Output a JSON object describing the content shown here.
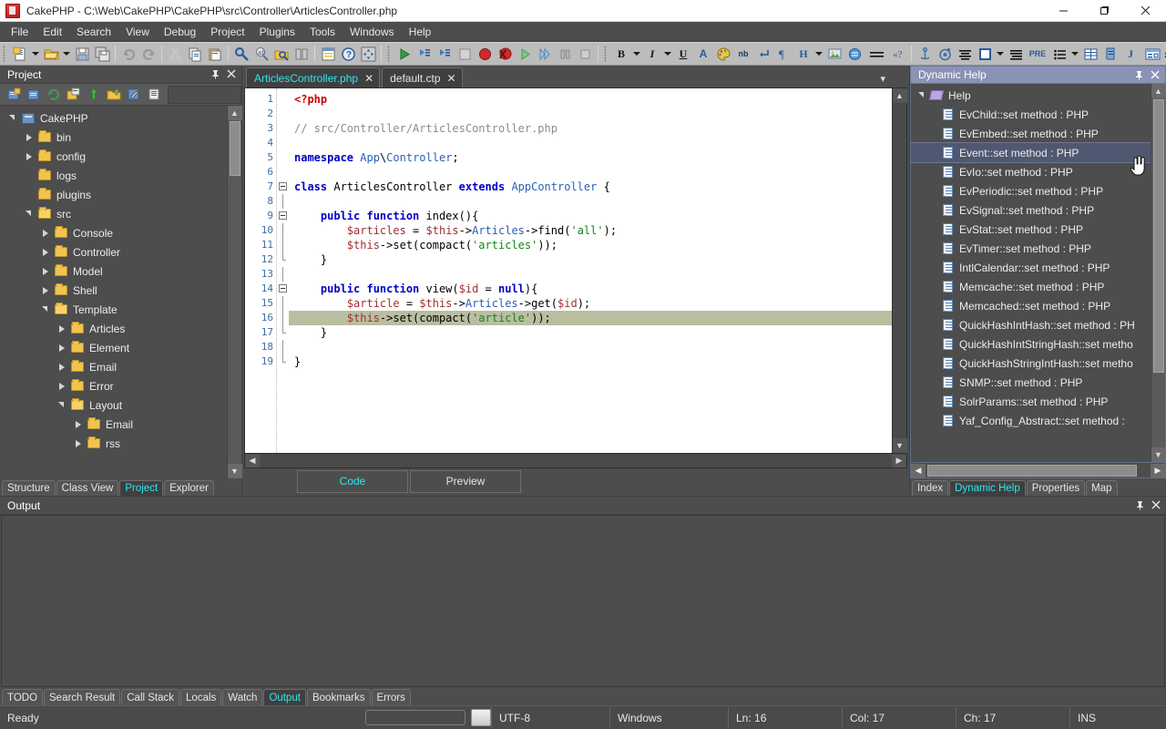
{
  "window": {
    "title": "CakePHP - C:\\Web\\CakePHP\\CakePHP\\src\\Controller\\ArticlesController.php",
    "app_icon": "cakephp-icon",
    "minimize": "—",
    "maximize": "❑",
    "close": "✕"
  },
  "menubar": {
    "items": [
      "File",
      "Edit",
      "Search",
      "View",
      "Debug",
      "Project",
      "Plugins",
      "Tools",
      "Windows",
      "Help"
    ]
  },
  "toolbar": {
    "overflow": "»",
    "groups": [
      {
        "name": "file",
        "buttons": [
          {
            "icon": "new-file-icon",
            "dropdown": true
          },
          {
            "icon": "open-folder-icon",
            "dropdown": true
          },
          {
            "icon": "save-icon",
            "dropdown": false
          },
          {
            "icon": "save-all-icon",
            "dropdown": false
          }
        ]
      },
      {
        "name": "history",
        "buttons": [
          {
            "icon": "undo-icon",
            "dropdown": false
          },
          {
            "icon": "redo-icon",
            "dropdown": false
          }
        ]
      },
      {
        "name": "clipboard",
        "buttons": [
          {
            "icon": "cut-icon",
            "dropdown": false
          },
          {
            "icon": "copy-icon",
            "dropdown": false
          },
          {
            "icon": "paste-icon",
            "dropdown": false
          }
        ]
      },
      {
        "name": "find",
        "buttons": [
          {
            "icon": "find-icon",
            "dropdown": false
          },
          {
            "icon": "replace-icon",
            "dropdown": false
          },
          {
            "icon": "find-in-files-icon",
            "dropdown": false
          },
          {
            "icon": "find-next-icon",
            "dropdown": false
          }
        ]
      },
      {
        "name": "tools",
        "buttons": [
          {
            "icon": "grid-icon",
            "dropdown": false
          },
          {
            "icon": "help-icon",
            "dropdown": false
          },
          {
            "icon": "move-icon",
            "dropdown": false
          }
        ]
      },
      {
        "name": "debug",
        "buttons": [
          {
            "icon": "run-icon",
            "dropdown": false
          },
          {
            "icon": "step-into-icon",
            "dropdown": false
          },
          {
            "icon": "step-over-icon",
            "dropdown": false
          },
          {
            "icon": "step-out-icon",
            "dropdown": false
          },
          {
            "icon": "breakpoint-icon",
            "dropdown": false
          },
          {
            "icon": "remove-breakpoints-icon",
            "dropdown": false
          },
          {
            "icon": "resume-icon",
            "dropdown": false
          },
          {
            "icon": "run-to-cursor-icon",
            "dropdown": false
          },
          {
            "icon": "pause-icon",
            "dropdown": false
          },
          {
            "icon": "stop-icon",
            "dropdown": false
          }
        ]
      },
      {
        "name": "format",
        "buttons": [
          {
            "icon": "bold-icon",
            "label": "B",
            "dropdown": true
          },
          {
            "icon": "italic-icon",
            "label": "I",
            "dropdown": true
          },
          {
            "icon": "underline-icon",
            "label": "U",
            "dropdown": false
          },
          {
            "icon": "font-color-icon",
            "label": "A",
            "dropdown": false
          },
          {
            "icon": "palette-icon",
            "dropdown": false
          },
          {
            "icon": "nbsp-icon",
            "label": "nb",
            "dropdown": false
          },
          {
            "icon": "line-break-icon",
            "dropdown": false
          },
          {
            "icon": "paragraph-icon",
            "dropdown": false
          },
          {
            "icon": "heading-icon",
            "label": "H",
            "dropdown": true
          },
          {
            "icon": "image-icon",
            "dropdown": false
          },
          {
            "icon": "link-icon",
            "dropdown": false
          },
          {
            "icon": "horizontal-rule-icon",
            "dropdown": false
          },
          {
            "icon": "comment-icon",
            "dropdown": false
          }
        ]
      },
      {
        "name": "html",
        "buttons": [
          {
            "icon": "anchor-icon",
            "dropdown": false
          },
          {
            "icon": "target-icon",
            "dropdown": false
          },
          {
            "icon": "align-center-icon",
            "dropdown": false
          },
          {
            "icon": "border-icon",
            "dropdown": true
          },
          {
            "icon": "align-justify-icon",
            "dropdown": false
          },
          {
            "icon": "pre-icon",
            "label": "PRE",
            "dropdown": false
          },
          {
            "icon": "list-icon",
            "dropdown": true
          },
          {
            "icon": "table-icon",
            "dropdown": false
          },
          {
            "icon": "script-icon",
            "dropdown": false
          },
          {
            "icon": "javascript-icon",
            "label": "J",
            "dropdown": false
          },
          {
            "icon": "form-icon",
            "dropdown": false
          }
        ]
      }
    ]
  },
  "project_panel": {
    "title": "Project",
    "pin": "📌",
    "close": "✕",
    "toolbar": [
      {
        "icon": "new-project-icon"
      },
      {
        "icon": "open-project-icon"
      },
      {
        "icon": "refresh-icon"
      },
      {
        "icon": "project-properties-icon"
      },
      {
        "icon": "upload-icon"
      },
      {
        "icon": "download-icon"
      },
      {
        "icon": "edit-project-icon"
      },
      {
        "icon": "project-file-icon"
      }
    ],
    "tree": [
      {
        "label": "CakePHP",
        "depth": 0,
        "state": "expanded",
        "icon": "project-icon"
      },
      {
        "label": "bin",
        "depth": 1,
        "state": "collapsed",
        "icon": "folder-icon"
      },
      {
        "label": "config",
        "depth": 1,
        "state": "collapsed",
        "icon": "folder-icon"
      },
      {
        "label": "logs",
        "depth": 1,
        "state": "leaf",
        "icon": "folder-icon"
      },
      {
        "label": "plugins",
        "depth": 1,
        "state": "leaf",
        "icon": "folder-icon"
      },
      {
        "label": "src",
        "depth": 1,
        "state": "expanded",
        "icon": "folder-icon"
      },
      {
        "label": "Console",
        "depth": 2,
        "state": "collapsed",
        "icon": "folder-icon"
      },
      {
        "label": "Controller",
        "depth": 2,
        "state": "collapsed",
        "icon": "folder-icon"
      },
      {
        "label": "Model",
        "depth": 2,
        "state": "collapsed",
        "icon": "folder-icon"
      },
      {
        "label": "Shell",
        "depth": 2,
        "state": "collapsed",
        "icon": "folder-icon"
      },
      {
        "label": "Template",
        "depth": 2,
        "state": "expanded",
        "icon": "folder-icon"
      },
      {
        "label": "Articles",
        "depth": 3,
        "state": "collapsed",
        "icon": "folder-icon"
      },
      {
        "label": "Element",
        "depth": 3,
        "state": "collapsed",
        "icon": "folder-icon"
      },
      {
        "label": "Email",
        "depth": 3,
        "state": "collapsed",
        "icon": "folder-icon"
      },
      {
        "label": "Error",
        "depth": 3,
        "state": "collapsed",
        "icon": "folder-icon"
      },
      {
        "label": "Layout",
        "depth": 3,
        "state": "expanded",
        "icon": "folder-icon"
      },
      {
        "label": "Email",
        "depth": 4,
        "state": "collapsed",
        "icon": "folder-icon"
      },
      {
        "label": "rss",
        "depth": 4,
        "state": "collapsed",
        "icon": "folder-icon"
      }
    ],
    "tabs": [
      {
        "label": "Structure",
        "active": false
      },
      {
        "label": "Class View",
        "active": false
      },
      {
        "label": "Project",
        "active": true
      },
      {
        "label": "Explorer",
        "active": false
      }
    ]
  },
  "editor": {
    "tabs": [
      {
        "label": "ArticlesController.php",
        "active": true,
        "close": "✕"
      },
      {
        "label": "default.ctp",
        "active": false,
        "close": "✕"
      }
    ],
    "tab_menu": "▾",
    "line_numbers": [
      "1",
      "2",
      "3",
      "4",
      "5",
      "6",
      "7",
      "8",
      "9",
      "10",
      "11",
      "12",
      "13",
      "14",
      "15",
      "16",
      "17",
      "18",
      "19"
    ],
    "highlighted_line": 16,
    "lines": [
      {
        "n": 1,
        "fold": "none",
        "tokens": [
          {
            "t": "<?php",
            "c": "php"
          }
        ]
      },
      {
        "n": 2,
        "fold": "none",
        "tokens": []
      },
      {
        "n": 3,
        "fold": "none",
        "tokens": [
          {
            "t": "// src/Controller/ArticlesController.php",
            "c": "cm"
          }
        ]
      },
      {
        "n": 4,
        "fold": "none",
        "tokens": []
      },
      {
        "n": 5,
        "fold": "none",
        "tokens": [
          {
            "t": "namespace ",
            "c": "k"
          },
          {
            "t": "App",
            "c": "cls"
          },
          {
            "t": "\\",
            "c": ""
          },
          {
            "t": "Controller",
            "c": "cls"
          },
          {
            "t": ";",
            "c": ""
          }
        ]
      },
      {
        "n": 6,
        "fold": "none",
        "tokens": []
      },
      {
        "n": 7,
        "fold": "start",
        "tokens": [
          {
            "t": "class ",
            "c": "k"
          },
          {
            "t": "ArticlesController ",
            "c": ""
          },
          {
            "t": "extends ",
            "c": "k"
          },
          {
            "t": "AppController",
            "c": "cls"
          },
          {
            "t": " {",
            "c": ""
          }
        ]
      },
      {
        "n": 8,
        "fold": "line",
        "tokens": []
      },
      {
        "n": 9,
        "fold": "start2",
        "tokens": [
          {
            "t": "    ",
            "c": ""
          },
          {
            "t": "public function ",
            "c": "k"
          },
          {
            "t": "index(){",
            "c": ""
          }
        ]
      },
      {
        "n": 10,
        "fold": "line",
        "tokens": [
          {
            "t": "        ",
            "c": ""
          },
          {
            "t": "$articles",
            "c": "va"
          },
          {
            "t": " = ",
            "c": ""
          },
          {
            "t": "$this",
            "c": "va"
          },
          {
            "t": "->",
            "c": ""
          },
          {
            "t": "Articles",
            "c": "cls"
          },
          {
            "t": "->find(",
            "c": ""
          },
          {
            "t": "'all'",
            "c": "st"
          },
          {
            "t": ");",
            "c": ""
          }
        ]
      },
      {
        "n": 11,
        "fold": "line",
        "tokens": [
          {
            "t": "        ",
            "c": ""
          },
          {
            "t": "$this",
            "c": "va"
          },
          {
            "t": "->set(compact(",
            "c": ""
          },
          {
            "t": "'articles'",
            "c": "st"
          },
          {
            "t": "));",
            "c": ""
          }
        ]
      },
      {
        "n": 12,
        "fold": "end2",
        "tokens": [
          {
            "t": "    }",
            "c": ""
          }
        ]
      },
      {
        "n": 13,
        "fold": "line",
        "tokens": []
      },
      {
        "n": 14,
        "fold": "start2",
        "tokens": [
          {
            "t": "    ",
            "c": ""
          },
          {
            "t": "public function ",
            "c": "k"
          },
          {
            "t": "view(",
            "c": ""
          },
          {
            "t": "$id",
            "c": "va"
          },
          {
            "t": " = ",
            "c": ""
          },
          {
            "t": "null",
            "c": "k"
          },
          {
            "t": "){",
            "c": ""
          }
        ]
      },
      {
        "n": 15,
        "fold": "line",
        "tokens": [
          {
            "t": "        ",
            "c": ""
          },
          {
            "t": "$article",
            "c": "va"
          },
          {
            "t": " = ",
            "c": ""
          },
          {
            "t": "$this",
            "c": "va"
          },
          {
            "t": "->",
            "c": ""
          },
          {
            "t": "Articles",
            "c": "cls"
          },
          {
            "t": "->get(",
            "c": ""
          },
          {
            "t": "$id",
            "c": "va"
          },
          {
            "t": ");",
            "c": ""
          }
        ]
      },
      {
        "n": 16,
        "fold": "line",
        "tokens": [
          {
            "t": "        ",
            "c": ""
          },
          {
            "t": "$this",
            "c": "va"
          },
          {
            "t": "->set(compact(",
            "c": ""
          },
          {
            "t": "'article'",
            "c": "st"
          },
          {
            "t": "));",
            "c": ""
          }
        ]
      },
      {
        "n": 17,
        "fold": "end2",
        "tokens": [
          {
            "t": "    }",
            "c": ""
          }
        ]
      },
      {
        "n": 18,
        "fold": "line",
        "tokens": []
      },
      {
        "n": 19,
        "fold": "end",
        "tokens": [
          {
            "t": "}",
            "c": ""
          }
        ]
      }
    ],
    "view_tabs": [
      {
        "label": "Code",
        "active": true
      },
      {
        "label": "Preview",
        "active": false
      }
    ]
  },
  "help_panel": {
    "title": "Dynamic Help",
    "pin": "📌",
    "close": "✕",
    "root": {
      "label": "Help",
      "icon": "help-book-icon"
    },
    "items": [
      "EvChild::set method : PHP",
      "EvEmbed::set method : PHP",
      "Event::set method : PHP",
      "EvIo::set method : PHP",
      "EvPeriodic::set method : PHP",
      "EvSignal::set method : PHP",
      "EvStat::set method : PHP",
      "EvTimer::set method : PHP",
      "IntlCalendar::set method : PHP",
      "Memcache::set method : PHP",
      "Memcached::set method : PHP",
      "QuickHashIntHash::set method : PH",
      "QuickHashIntStringHash::set metho",
      "QuickHashStringIntHash::set metho",
      "SNMP::set method : PHP",
      "SolrParams::set method : PHP",
      "Yaf_Config_Abstract::set method :"
    ],
    "selected_index": 2,
    "tabs": [
      {
        "label": "Index",
        "active": false
      },
      {
        "label": "Dynamic Help",
        "active": true
      },
      {
        "label": "Properties",
        "active": false
      },
      {
        "label": "Map",
        "active": false
      }
    ]
  },
  "output_panel": {
    "title": "Output",
    "pin": "📌",
    "close": "✕",
    "content": "",
    "tabs": [
      {
        "label": "TODO",
        "active": false
      },
      {
        "label": "Search Result",
        "active": false
      },
      {
        "label": "Call Stack",
        "active": false
      },
      {
        "label": "Locals",
        "active": false
      },
      {
        "label": "Watch",
        "active": false
      },
      {
        "label": "Output",
        "active": true
      },
      {
        "label": "Bookmarks",
        "active": false
      },
      {
        "label": "Errors",
        "active": false
      }
    ]
  },
  "statusbar": {
    "ready": "Ready",
    "encoding": "UTF-8",
    "os": "Windows",
    "line": "Ln: 16",
    "column": "Col: 17",
    "char": "Ch: 17",
    "mode": "INS"
  },
  "colors": {
    "accent_cyan": "#2ee6f0",
    "panel_header": "#8a93b4",
    "chrome": "#4d4d4d",
    "toolbar": "#bcbcbc",
    "editor_bg": "#ffffff",
    "highlight_line": "#b9bea1",
    "selection": "#4f5870",
    "folder": "#f2c44d",
    "keyword": "#0000c8",
    "string": "#118811",
    "variable": "#a03030",
    "comment": "#8c8c8c",
    "php_tag": "#cc0000"
  }
}
